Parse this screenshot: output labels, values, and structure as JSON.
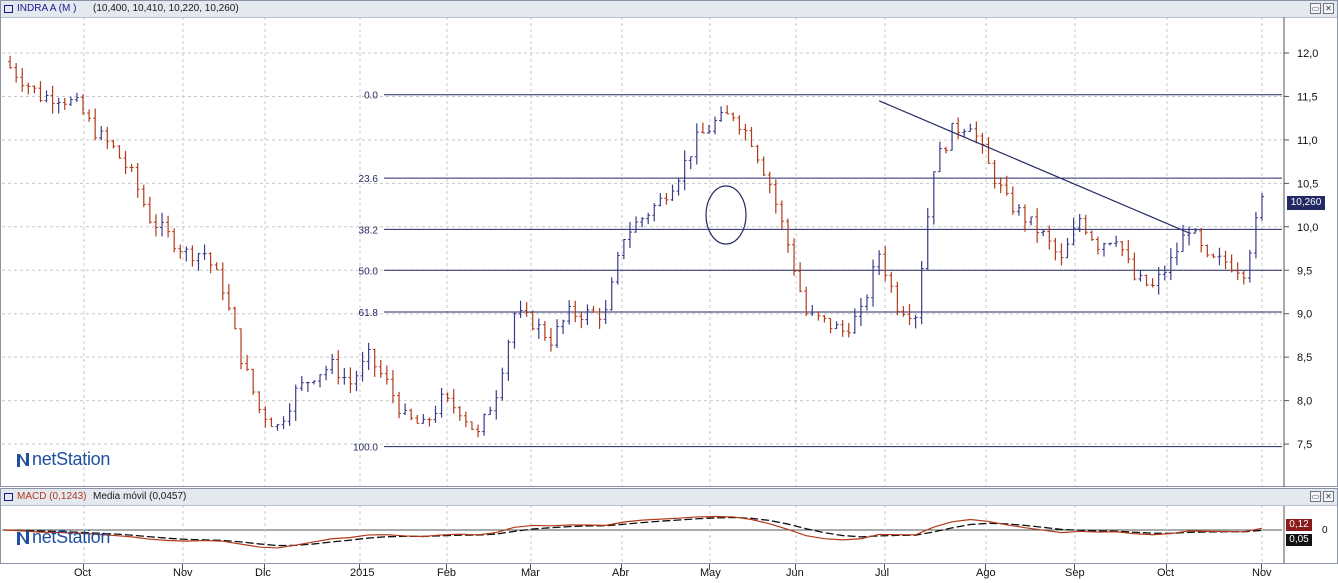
{
  "main_window": {
    "title_symbol": "INDRA A (M )",
    "title_values": "(10,400, 10,410, 10,220, 10,260)",
    "restore_glyph": "▭",
    "close_glyph": "✕"
  },
  "macd_window": {
    "title_macd": "MACD (0,1243)",
    "title_ma": "Media móvil (0,0457)",
    "restore_glyph": "▭",
    "close_glyph": "✕",
    "macd_value_label": "0,12",
    "ma_value_label": "0,05",
    "zero_label": "0"
  },
  "logo": {
    "brand": "netStation",
    "icon": "netstation-n-icon",
    "color": "#1f4fa0"
  },
  "price_label": "10,260",
  "colors": {
    "up_bar": "#3a3a8c",
    "down_bar": "#b23a1a",
    "fib_line": "#232a63",
    "macd_line": "#b23a1a",
    "ma_line": "#111111",
    "grid": "#c8c8c8",
    "accent_box": "#232a63"
  },
  "chart_data": {
    "type": "line",
    "subtype": "ohlc-bar",
    "title": "INDRA A (M )",
    "y_axis_labels": [
      "12,0",
      "11,5",
      "11,0",
      "10,5",
      "10,0",
      "9,5",
      "9,0",
      "8,5",
      "8,0",
      "7,5"
    ],
    "ylim": [
      7.05,
      12.35
    ],
    "grid": true,
    "x_labels": [
      "Oct",
      "Nov",
      "Dic",
      "2015",
      "Feb",
      "Mar",
      "Abr",
      "May",
      "Jun",
      "Jul",
      "Ago",
      "Sep",
      "Oct",
      "Nov"
    ],
    "fibonacci": {
      "levels": [
        {
          "label": "0.0",
          "value": 11.52
        },
        {
          "label": "23.6",
          "value": 10.56
        },
        {
          "label": "38.2",
          "value": 9.97
        },
        {
          "label": "50.0",
          "value": 9.5
        },
        {
          "label": "61.8",
          "value": 9.02
        },
        {
          "label": "100.0",
          "value": 7.47
        }
      ]
    },
    "trendline": {
      "from_week": 48,
      "from_value": 11.45,
      "to_week": 64,
      "to_value": 9.93
    },
    "close_series_weekly": [
      11.9,
      11.7,
      11.5,
      11.5,
      11.4,
      11.1,
      10.9,
      10.6,
      10.1,
      9.9,
      9.7,
      9.7,
      9.3,
      8.5,
      7.9,
      7.7,
      8.1,
      8.3,
      8.4,
      8.2,
      8.5,
      8.2,
      7.8,
      7.7,
      8.0,
      7.9,
      7.6,
      8.1,
      9.0,
      8.9,
      8.7,
      9.0,
      9.0,
      9.0,
      9.9,
      10.1,
      10.3,
      10.6,
      11.0,
      11.2,
      11.3,
      11.0,
      10.5,
      9.8,
      9.0,
      8.9,
      8.8,
      9.0,
      9.7,
      9.1,
      9.0,
      10.7,
      11.1,
      11.2,
      10.7,
      10.3,
      10.1,
      9.9,
      9.6,
      10.1,
      9.8,
      9.9,
      9.4,
      9.3,
      9.6,
      10.0,
      9.6,
      9.6,
      9.5,
      10.3
    ],
    "macd": {
      "macd_value": 0.1243,
      "ma_value": 0.0457,
      "zero_line": 0
    }
  }
}
